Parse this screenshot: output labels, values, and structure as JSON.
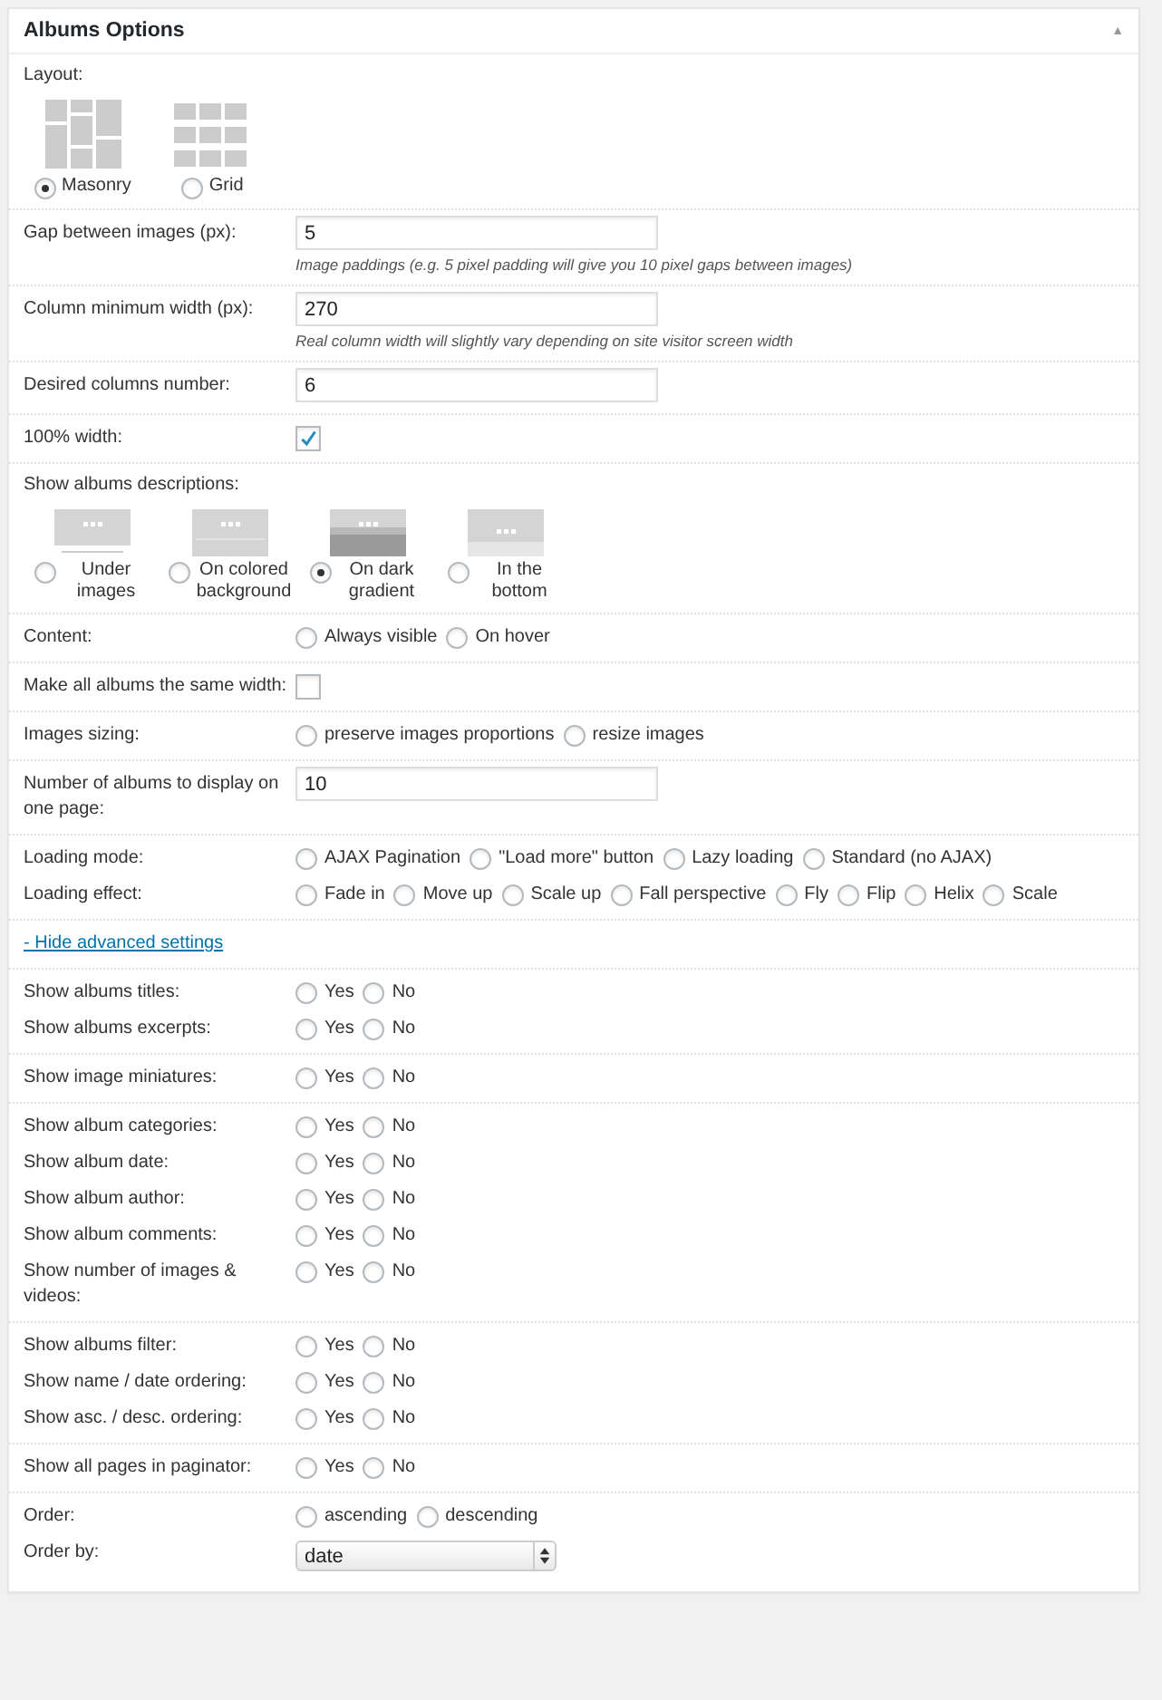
{
  "panel": {
    "title": "Albums Options",
    "collapse_icon": "▲"
  },
  "sections": [
    {
      "rows": [
        {
          "kind": "layout",
          "label": "Layout:",
          "options": [
            {
              "label": "Masonry",
              "kind": "masonry",
              "selected": true
            },
            {
              "label": "Grid",
              "kind": "grid",
              "selected": false
            }
          ]
        }
      ]
    },
    {
      "rows": [
        {
          "kind": "text",
          "label": "Gap between images (px):",
          "value": "5",
          "hint": "Image paddings (e.g. 5 pixel padding will give you 10 pixel gaps between images)"
        }
      ]
    },
    {
      "rows": [
        {
          "kind": "text",
          "label": "Column minimum width (px):",
          "value": "270",
          "hint": "Real column width will slightly vary depending on site visitor screen width"
        }
      ]
    },
    {
      "rows": [
        {
          "kind": "text",
          "label": "Desired columns number:",
          "value": "6"
        }
      ]
    },
    {
      "rows": [
        {
          "kind": "checkbox",
          "label": "100% width:",
          "checked": true
        }
      ]
    },
    {
      "rows": [
        {
          "kind": "thumbs",
          "label": "Show albums descriptions:",
          "options": [
            {
              "label": "Under images",
              "kind": "under",
              "selected": false
            },
            {
              "label": "On colored background",
              "kind": "colored",
              "selected": false
            },
            {
              "label": "On dark gradient",
              "kind": "gradient",
              "selected": true
            },
            {
              "label": "In the bottom",
              "kind": "bottom",
              "selected": false
            }
          ]
        }
      ]
    },
    {
      "rows": [
        {
          "kind": "radio",
          "label": "Content:",
          "options": [
            {
              "label": "Always visible",
              "selected": false
            },
            {
              "label": "On hover",
              "selected": false
            }
          ]
        }
      ]
    },
    {
      "rows": [
        {
          "kind": "checkbox",
          "label": "Make all albums the same width:",
          "checked": false
        }
      ]
    },
    {
      "rows": [
        {
          "kind": "radio",
          "label": "Images sizing:",
          "options": [
            {
              "label": "preserve images proportions",
              "selected": false
            },
            {
              "label": "resize images",
              "selected": false
            }
          ]
        }
      ]
    },
    {
      "rows": [
        {
          "kind": "text",
          "label": "Number of albums to display on one page:",
          "value": "10"
        }
      ]
    },
    {
      "rows": [
        {
          "kind": "radio",
          "label": "Loading mode:",
          "options": [
            {
              "label": "AJAX Pagination",
              "selected": false
            },
            {
              "label": "\"Load more\" button",
              "selected": false
            },
            {
              "label": "Lazy loading",
              "selected": false
            },
            {
              "label": "Standard (no AJAX)",
              "selected": false
            }
          ]
        },
        {
          "kind": "radio",
          "label": "Loading effect:",
          "options": [
            {
              "label": "Fade in",
              "selected": false
            },
            {
              "label": "Move up",
              "selected": false
            },
            {
              "label": "Scale up",
              "selected": false
            },
            {
              "label": "Fall perspective",
              "selected": false
            },
            {
              "label": "Fly",
              "selected": false
            },
            {
              "label": "Flip",
              "selected": false
            },
            {
              "label": "Helix",
              "selected": false
            },
            {
              "label": "Scale",
              "selected": false
            }
          ]
        }
      ]
    },
    {
      "rows": [
        {
          "kind": "link",
          "label": "- Hide advanced settings"
        }
      ]
    },
    {
      "rows": [
        {
          "kind": "radio",
          "label": "Show albums titles:",
          "options": [
            {
              "label": "Yes",
              "selected": false
            },
            {
              "label": "No",
              "selected": false
            }
          ]
        },
        {
          "kind": "radio",
          "label": "Show albums excerpts:",
          "options": [
            {
              "label": "Yes",
              "selected": false
            },
            {
              "label": "No",
              "selected": false
            }
          ]
        }
      ]
    },
    {
      "rows": [
        {
          "kind": "radio",
          "label": "Show image miniatures:",
          "options": [
            {
              "label": "Yes",
              "selected": false
            },
            {
              "label": "No",
              "selected": false
            }
          ]
        }
      ]
    },
    {
      "rows": [
        {
          "kind": "radio",
          "label": "Show album categories:",
          "options": [
            {
              "label": "Yes",
              "selected": false
            },
            {
              "label": "No",
              "selected": false
            }
          ]
        },
        {
          "kind": "radio",
          "label": "Show album date:",
          "options": [
            {
              "label": "Yes",
              "selected": false
            },
            {
              "label": "No",
              "selected": false
            }
          ]
        },
        {
          "kind": "radio",
          "label": "Show album author:",
          "options": [
            {
              "label": "Yes",
              "selected": false
            },
            {
              "label": "No",
              "selected": false
            }
          ]
        },
        {
          "kind": "radio",
          "label": "Show album comments:",
          "options": [
            {
              "label": "Yes",
              "selected": false
            },
            {
              "label": "No",
              "selected": false
            }
          ]
        },
        {
          "kind": "radio",
          "label": "Show number of images & videos:",
          "options": [
            {
              "label": "Yes",
              "selected": false
            },
            {
              "label": "No",
              "selected": false
            }
          ]
        }
      ]
    },
    {
      "rows": [
        {
          "kind": "radio",
          "label": "Show albums filter:",
          "options": [
            {
              "label": "Yes",
              "selected": false
            },
            {
              "label": "No",
              "selected": false
            }
          ]
        },
        {
          "kind": "radio",
          "label": "Show name / date ordering:",
          "options": [
            {
              "label": "Yes",
              "selected": false
            },
            {
              "label": "No",
              "selected": false
            }
          ]
        },
        {
          "kind": "radio",
          "label": "Show asc. / desc. ordering:",
          "options": [
            {
              "label": "Yes",
              "selected": false
            },
            {
              "label": "No",
              "selected": false
            }
          ]
        }
      ]
    },
    {
      "rows": [
        {
          "kind": "radio",
          "label": "Show all pages in paginator:",
          "options": [
            {
              "label": "Yes",
              "selected": false
            },
            {
              "label": "No",
              "selected": false
            }
          ]
        }
      ]
    },
    {
      "rows": [
        {
          "kind": "radio",
          "label": "Order:",
          "options": [
            {
              "label": "ascending",
              "selected": false
            },
            {
              "label": "descending",
              "selected": false
            }
          ]
        },
        {
          "kind": "select",
          "label": "Order by:",
          "value": "date"
        }
      ]
    }
  ]
}
